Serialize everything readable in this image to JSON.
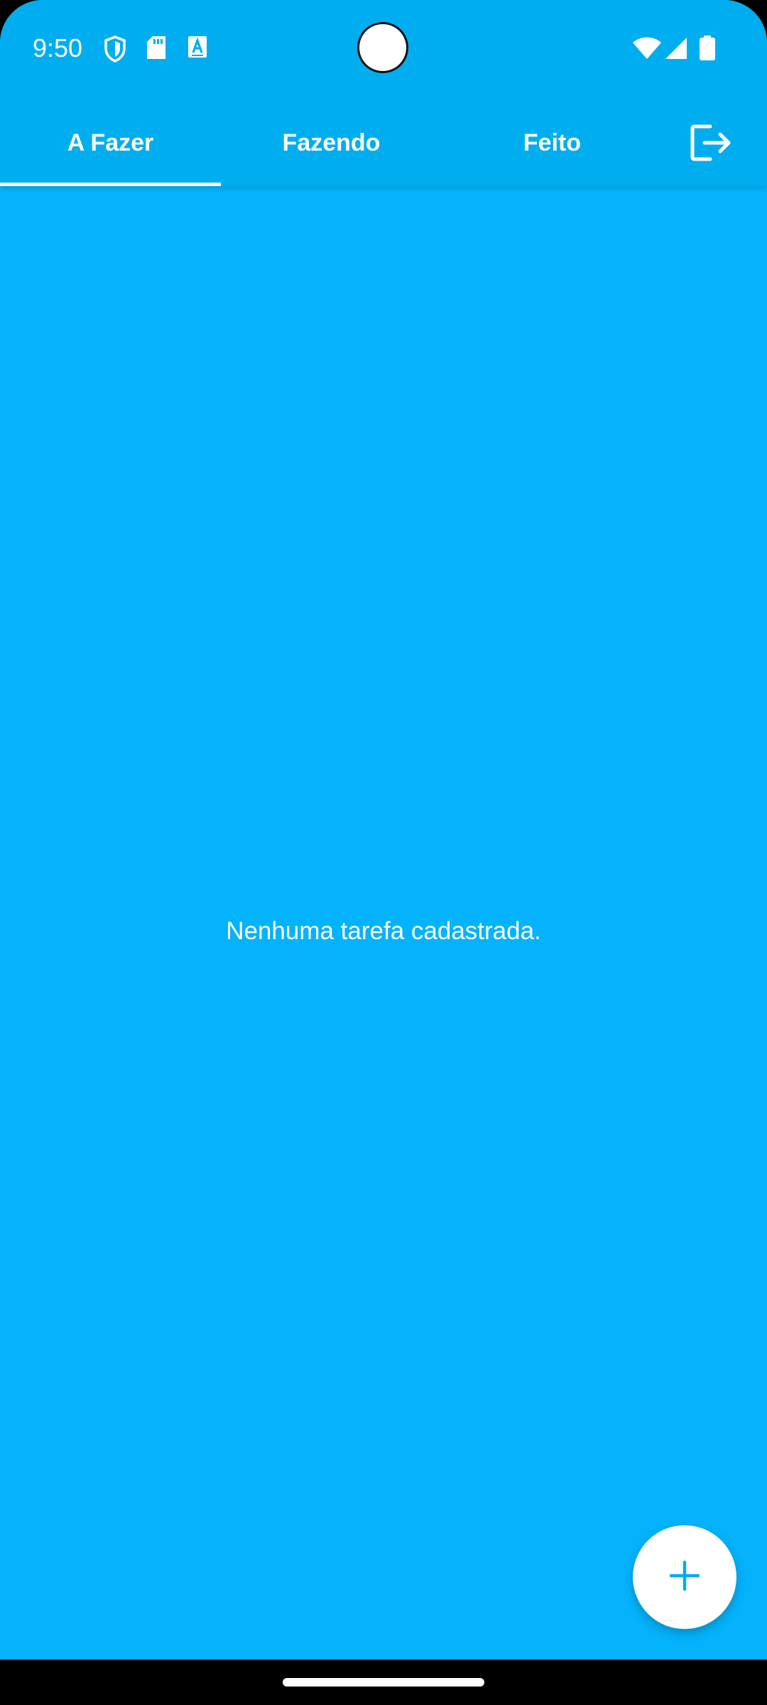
{
  "status_bar": {
    "time": "9:50",
    "icons": [
      "shield-icon",
      "sd-card-icon",
      "font-a-icon",
      "wifi-icon",
      "signal-icon",
      "battery-icon"
    ]
  },
  "tabs": [
    {
      "label": "A Fazer",
      "selected": true
    },
    {
      "label": "Fazendo",
      "selected": false
    },
    {
      "label": "Feito",
      "selected": false
    }
  ],
  "actions": {
    "logout_icon": "logout-icon",
    "fab_icon": "plus-icon"
  },
  "main": {
    "empty_message": "Nenhuma tarefa cadastrada."
  },
  "colors": {
    "primary": "#04B3FB",
    "app_bar": "#00AEEF",
    "on_primary": "#FFFFFF",
    "fab_background": "#FFFFFF",
    "fab_icon": "#00AEEF"
  }
}
